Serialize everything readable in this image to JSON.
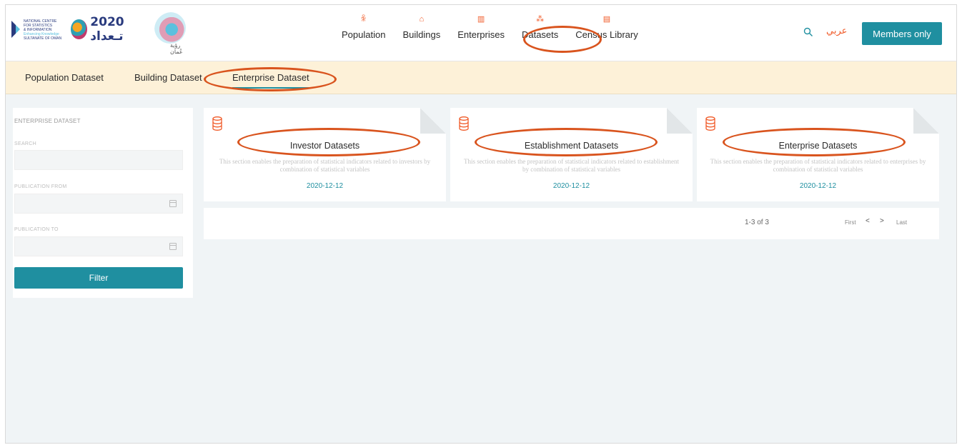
{
  "header": {
    "logos": {
      "ncsi_lines": [
        "NATIONAL CENTRE",
        "FOR STATISTICS",
        "& INFORMATION",
        "Enhancing Knowledge",
        "SULTANATE OF OMAN"
      ],
      "census_text": "2020 تـعداد",
      "vision_text": "رؤية عُمان"
    },
    "nav": [
      {
        "label": "Population",
        "icon": "population-icon",
        "glyph": "ꆜ"
      },
      {
        "label": "Buildings",
        "icon": "buildings-icon",
        "glyph": "⌂"
      },
      {
        "label": "Enterprises",
        "icon": "enterprises-icon",
        "glyph": "▥"
      },
      {
        "label": "Datasets",
        "icon": "datasets-icon",
        "glyph": "⁂"
      },
      {
        "label": "Census Library",
        "icon": "library-icon",
        "glyph": "▤"
      }
    ],
    "lang_label": "عربي",
    "members_label": "Members only"
  },
  "subnav": {
    "tabs": [
      {
        "label": "Population Dataset",
        "active": false
      },
      {
        "label": "Building Dataset",
        "active": false
      },
      {
        "label": "Enterprise Dataset",
        "active": true
      }
    ]
  },
  "sidebar": {
    "title": "ENTERPRISE DATASET",
    "search_label": "SEARCH",
    "search_value": "",
    "from_label": "PUBLICATION FROM",
    "from_value": "",
    "to_label": "PUBLICATION TO",
    "to_value": "",
    "filter_label": "Filter"
  },
  "cards": [
    {
      "title": "Investor Datasets",
      "description": "This section enables the preparation of statistical indicators related to investors by combination of statistical variables",
      "date": "2020-12-12"
    },
    {
      "title": "Establishment Datasets",
      "description": "This section enables the preparation of statistical indicators related to establishment by combination of statistical variables",
      "date": "2020-12-12"
    },
    {
      "title": "Enterprise Datasets",
      "description": "This section enables the preparation of statistical indicators related to enterprises by combination of statistical variables",
      "date": "2020-12-12"
    }
  ],
  "pagination": {
    "range": "1-3 of 3",
    "first": "First",
    "prev": "<",
    "next": ">",
    "last": "Last"
  },
  "colors": {
    "accent": "#1f8fa0",
    "orange": "#f05a28",
    "highlight": "#d9541e",
    "subnav_bg": "#fdf1d8"
  }
}
